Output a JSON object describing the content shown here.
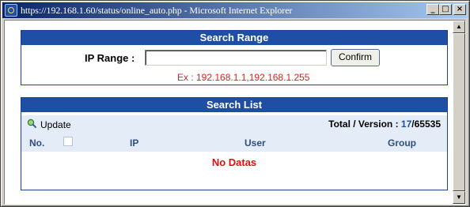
{
  "window": {
    "title": "https://192.168.1.60/status/online_auto.php - Microsoft Internet Explorer",
    "minimize_glyph": "_",
    "maximize_glyph": "□",
    "close_glyph": "×"
  },
  "scrollbar": {
    "up_glyph": "▲",
    "down_glyph": "▼"
  },
  "search_range": {
    "header": "Search Range",
    "ip_label": "IP Range :",
    "ip_value": "",
    "ip_placeholder": "",
    "confirm_label": "Confirm",
    "example": "Ex : 192.168.1.1,192.168.1.255"
  },
  "search_list": {
    "header": "Search List",
    "update_label": "Update",
    "total_label": "Total / Version : ",
    "total_count": "17",
    "total_separator": "/",
    "total_version": "65535",
    "columns": {
      "no": "No.",
      "ip": "IP",
      "user": "User",
      "group": "Group"
    },
    "empty_message": "No Datas"
  },
  "colors": {
    "header_bg": "#1f4ea5",
    "row_bg": "#e4ecf7",
    "example_text": "#e02020",
    "empty_text": "#e01010",
    "titlebar_start": "#0a246a",
    "titlebar_end": "#a6caf0"
  },
  "icons": {
    "browser": "ie-icon",
    "update": "refresh-magnifier-icon"
  }
}
